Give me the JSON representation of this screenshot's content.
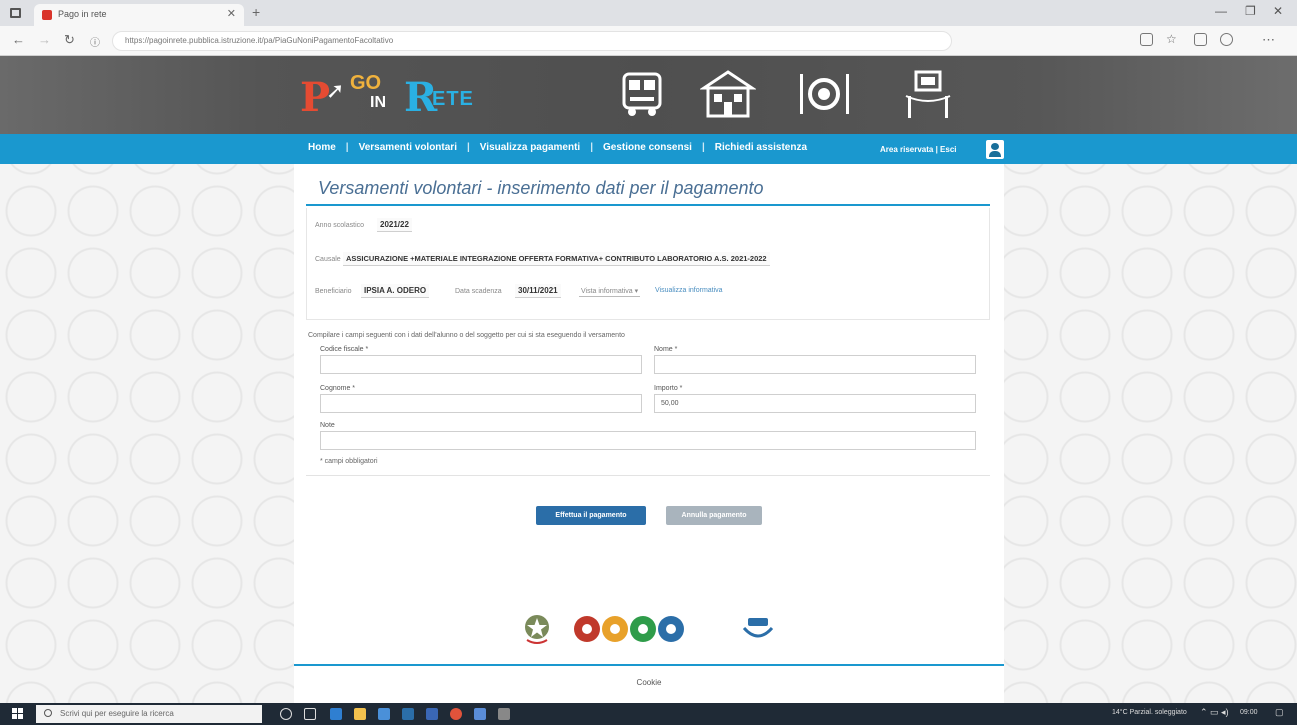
{
  "browser": {
    "tab_title": "Pago in rete",
    "url": "https://pagoinrete.pubblica.istruzione.it/pa/PiaGuNoniPagamentoFacoltativo"
  },
  "site": {
    "logo": {
      "p": "P",
      "go": "GO",
      "in": "IN",
      "r": "R",
      "ete": "ETE"
    },
    "menu": [
      {
        "label": "Home"
      },
      {
        "label": "Versamenti volontari"
      },
      {
        "label": "Visualizza pagamenti"
      },
      {
        "label": "Gestione consensi"
      },
      {
        "label": "Richiedi assistenza"
      }
    ],
    "area_riservata": "Area riservata | Esci"
  },
  "form": {
    "heading": "Versamenti volontari - inserimento dati per il pagamento",
    "anno_label": "Anno scolastico",
    "anno_value": "2021/22",
    "causale_label": "Causale",
    "causale_value": "ASSICURAZIONE +MATERIALE INTEGRAZIONE OFFERTA FORMATIVA+ CONTRIBUTO LABORATORIO A.S. 2021-2022",
    "beneficiario_label": "Beneficiario",
    "beneficiario_value": "IPSIA A. ODERO",
    "scadenza_label": "Data scadenza",
    "scadenza_value": "30/11/2021",
    "info_select": "Vista informativa",
    "info_link": "Visualizza informativa",
    "instructions": "Compilare i campi seguenti con i dati dell'alunno o del soggetto per cui si sta eseguendo il versamento",
    "codice_fiscale_label": "Codice fiscale *",
    "codice_fiscale_value": "",
    "nome_label": "Nome *",
    "nome_value": "",
    "cognome_label": "Cognome *",
    "cognome_value": "",
    "importo_label": "Importo *",
    "importo_value": "50,00",
    "note_label": "Note",
    "note_value": "",
    "required_note": "* campi obbligatori",
    "pay_button": "Effettua il pagamento",
    "cancel_button": "Annulla pagamento",
    "footer_link": "Cookie"
  },
  "taskbar": {
    "search_placeholder": "Scrivi qui per eseguire la ricerca",
    "weather": "14°C Parzial. soleggiato",
    "time": "09:00"
  },
  "colors": {
    "nav_blue": "#1a98cf",
    "pay_button": "#2b6ea8",
    "heading": "#4a6f94",
    "logo_red": "#e54b32",
    "logo_blue": "#2ab0e3"
  }
}
